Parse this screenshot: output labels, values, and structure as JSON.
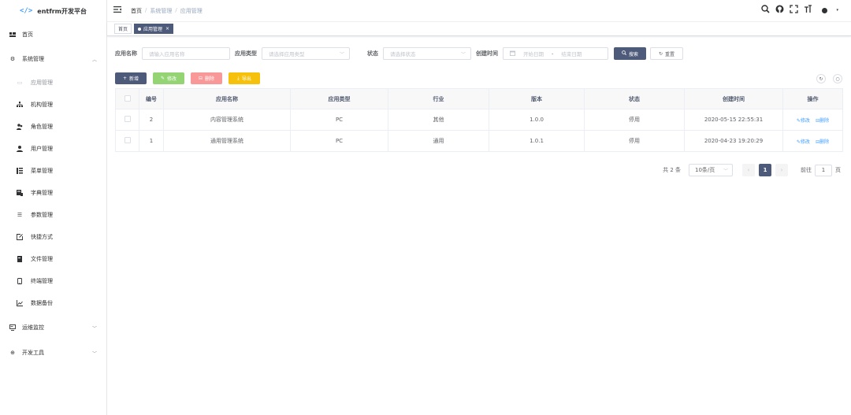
{
  "app": {
    "logo": "</>",
    "title": "entfrm开发平台"
  },
  "colors": {
    "primary": "#4e5a7a",
    "success": "#95d475",
    "danger": "#f89898",
    "warning": "#f5c10c",
    "link": "#409eff"
  },
  "sidebar": {
    "home": {
      "label": "首页",
      "icon": "dashboard-icon"
    },
    "system": {
      "label": "系统管理",
      "icon": "gear-icon"
    },
    "items": [
      {
        "label": "应用管理",
        "icon": "app-icon"
      },
      {
        "label": "机构管理",
        "icon": "org-tree-icon"
      },
      {
        "label": "角色管理",
        "icon": "role-users-icon"
      },
      {
        "label": "用户管理",
        "icon": "user-icon"
      },
      {
        "label": "菜单管理",
        "icon": "tree-table-icon"
      },
      {
        "label": "字典管理",
        "icon": "dict-icon"
      },
      {
        "label": "参数管理",
        "icon": "list-icon"
      },
      {
        "label": "快捷方式",
        "icon": "shortcut-icon"
      },
      {
        "label": "文件管理",
        "icon": "file-icon"
      },
      {
        "label": "终端管理",
        "icon": "phone-icon"
      },
      {
        "label": "数据备份",
        "icon": "chart-icon"
      }
    ],
    "monitor": {
      "label": "运维监控",
      "icon": "monitor-icon"
    },
    "devtools": {
      "label": "开发工具",
      "icon": "tools-icon"
    }
  },
  "breadcrumb": {
    "home": "首页",
    "level1": "系统管理",
    "level2": "应用管理",
    "sep": "/"
  },
  "tags": {
    "home": "首页",
    "current": "应用管理",
    "close": "×"
  },
  "search": {
    "name_label": "应用名称",
    "name_placeholder": "请输入应用名称",
    "type_label": "应用类型",
    "type_placeholder": "请选择应用类型",
    "status_label": "状态",
    "status_placeholder": "请选择状态",
    "time_label": "创建时间",
    "start_placeholder": "开始日期",
    "range_sep": "-",
    "end_placeholder": "结束日期",
    "search_btn": "搜索",
    "reset_btn": "重置"
  },
  "toolbar": {
    "add": "新增",
    "edit": "修改",
    "delete": "删除",
    "export": "导出"
  },
  "table": {
    "headers": [
      "编号",
      "应用名称",
      "应用类型",
      "行业",
      "版本",
      "状态",
      "创建时间",
      "操作"
    ],
    "rows": [
      {
        "id": "2",
        "name": "内容管理系统",
        "type": "PC",
        "industry": "其他",
        "version": "1.0.0",
        "status": "停用",
        "created": "2020-05-15 22:55:31"
      },
      {
        "id": "1",
        "name": "通用管理系统",
        "type": "PC",
        "industry": "通用",
        "version": "1.0.1",
        "status": "停用",
        "created": "2020-04-23 19:20:29"
      }
    ],
    "edit_label": "修改",
    "delete_label": "删除"
  },
  "pagination": {
    "total": "共 2 条",
    "page_size": "10条/页",
    "current_page": "1",
    "goto_label": "前往",
    "goto_value": "1",
    "page_unit": "页"
  }
}
